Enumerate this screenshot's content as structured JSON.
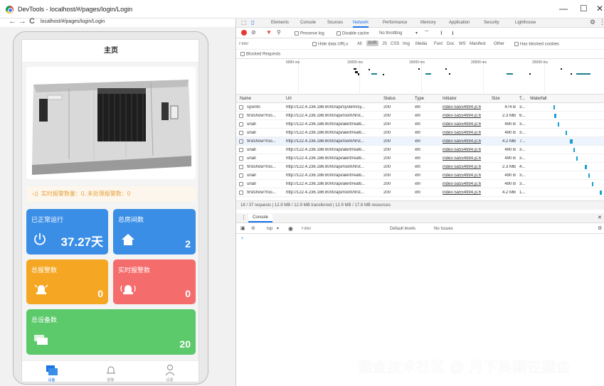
{
  "window": {
    "title": "DevTools - localhost/#/pages/login/Login",
    "minimize": "—",
    "maximize": "☐",
    "close": "✕"
  },
  "browser": {
    "url": "localhost/#/pages/login/Login",
    "back": "←",
    "forward": "→",
    "reload": "C"
  },
  "app": {
    "header_title": "主页",
    "alert_text": "实时报警数量：0, 未处理报警数：0",
    "cards": [
      {
        "title": "已正常运行",
        "value": "37.27天",
        "color": "#3a8ee6"
      },
      {
        "title": "总房间数",
        "value": "2",
        "color": "#3a8ee6"
      },
      {
        "title": "总报警数",
        "value": "0",
        "color": "#f5a623"
      },
      {
        "title": "实时报警数",
        "value": "0",
        "color": "#f56c6c"
      },
      {
        "title": "总设备数",
        "value": "20",
        "color": "#5cc96b"
      }
    ],
    "tabs": [
      {
        "label": "设备"
      },
      {
        "label": "报警"
      },
      {
        "label": "设置"
      }
    ]
  },
  "devtools": {
    "tabs": [
      "Elements",
      "Console",
      "Sources",
      "Network",
      "Performance",
      "Memory",
      "Application",
      "Security",
      "Lighthouse"
    ],
    "active_tab": "Network",
    "toolbar": {
      "preserve_log": "Preserve log",
      "disable_cache": "Disable cache",
      "throttling": "No throttling"
    },
    "filter": {
      "placeholder": "Filter",
      "hide_data_urls": "Hide data URLs",
      "types": [
        "All",
        "XHR",
        "JS",
        "CSS",
        "Img",
        "Media",
        "Font",
        "Doc",
        "WS",
        "Manifest",
        "Other"
      ],
      "blocked_cookies": "Has blocked cookies",
      "blocked_requests": "Blocked Requests"
    },
    "overview_labels": [
      "5000 ms",
      "10000 ms",
      "15000 ms",
      "20000 ms",
      "25000 ms"
    ],
    "columns": [
      "Name",
      "Url",
      "Status",
      "Type",
      "Initiator",
      "Size",
      "T...",
      "Waterfall"
    ],
    "rows": [
      {
        "name": "sysinfo",
        "url": "http://122.4.236.186:8000/api/system/sy...",
        "status": "200",
        "type": "xhr",
        "initiator": "index-5a554994.js:6",
        "size": "474 B",
        "time": "3..."
      },
      {
        "name": "firstshow?roo...",
        "url": "http://122.4.236.186:8000/api/room/first...",
        "status": "200",
        "type": "xhr",
        "initiator": "index-5a554994.js:6",
        "size": "2.3 MB",
        "time": "6..."
      },
      {
        "name": "unall",
        "url": "http://122.4.236.186:8000/api/alert/realti...",
        "status": "200",
        "type": "xhr",
        "initiator": "index-5a554994.js:6",
        "size": "490 B",
        "time": "3..."
      },
      {
        "name": "unall",
        "url": "http://122.4.236.186:8000/api/alert/realti...",
        "status": "200",
        "type": "xhr",
        "initiator": "index-5a554994.js:6",
        "size": "490 B",
        "time": "3..."
      },
      {
        "name": "firstshow?roo...",
        "url": "http://122.4.236.186:8000/api/room/first...",
        "status": "200",
        "type": "xhr",
        "initiator": "index-5a554994.js:6",
        "size": "4.2 MB",
        "time": "7..."
      },
      {
        "name": "unall",
        "url": "http://122.4.236.186:8000/api/alert/realti...",
        "status": "200",
        "type": "xhr",
        "initiator": "index-5a554994.js:6",
        "size": "490 B",
        "time": "3..."
      },
      {
        "name": "unall",
        "url": "http://122.4.236.186:8000/api/alert/realti...",
        "status": "200",
        "type": "xhr",
        "initiator": "index-5a554994.js:6",
        "size": "490 B",
        "time": "3..."
      },
      {
        "name": "firstshow?roo...",
        "url": "http://122.4.236.186:8000/api/room/first...",
        "status": "200",
        "type": "xhr",
        "initiator": "index-5a554994.js:6",
        "size": "2.3 MB",
        "time": "4..."
      },
      {
        "name": "unall",
        "url": "http://122.4.236.186:8000/api/alert/realti...",
        "status": "200",
        "type": "xhr",
        "initiator": "index-5a554994.js:6",
        "size": "490 B",
        "time": "3..."
      },
      {
        "name": "unall",
        "url": "http://122.4.236.186:8000/api/alert/realti...",
        "status": "200",
        "type": "xhr",
        "initiator": "index-5a554994.js:6",
        "size": "490 B",
        "time": "3..."
      },
      {
        "name": "firstshow?roo...",
        "url": "http://122.4.236.186:8000/api/room/first...",
        "status": "200",
        "type": "xhr",
        "initiator": "index-5a554994.js:6",
        "size": "4.2 MB",
        "time": "1..."
      }
    ],
    "summary": "18 / 37 requests  |  12.9 MB / 12.9 MB transferred  |  12.9 MB / 17.8 MB resources",
    "console": {
      "tab": "Console",
      "context": "top",
      "filter_placeholder": "Filter",
      "levels": "Default levels",
      "issues": "No Issues",
      "prompt": "›"
    }
  },
  "watermark": "掘金技术社区 @ 月下吴刚在掘金"
}
